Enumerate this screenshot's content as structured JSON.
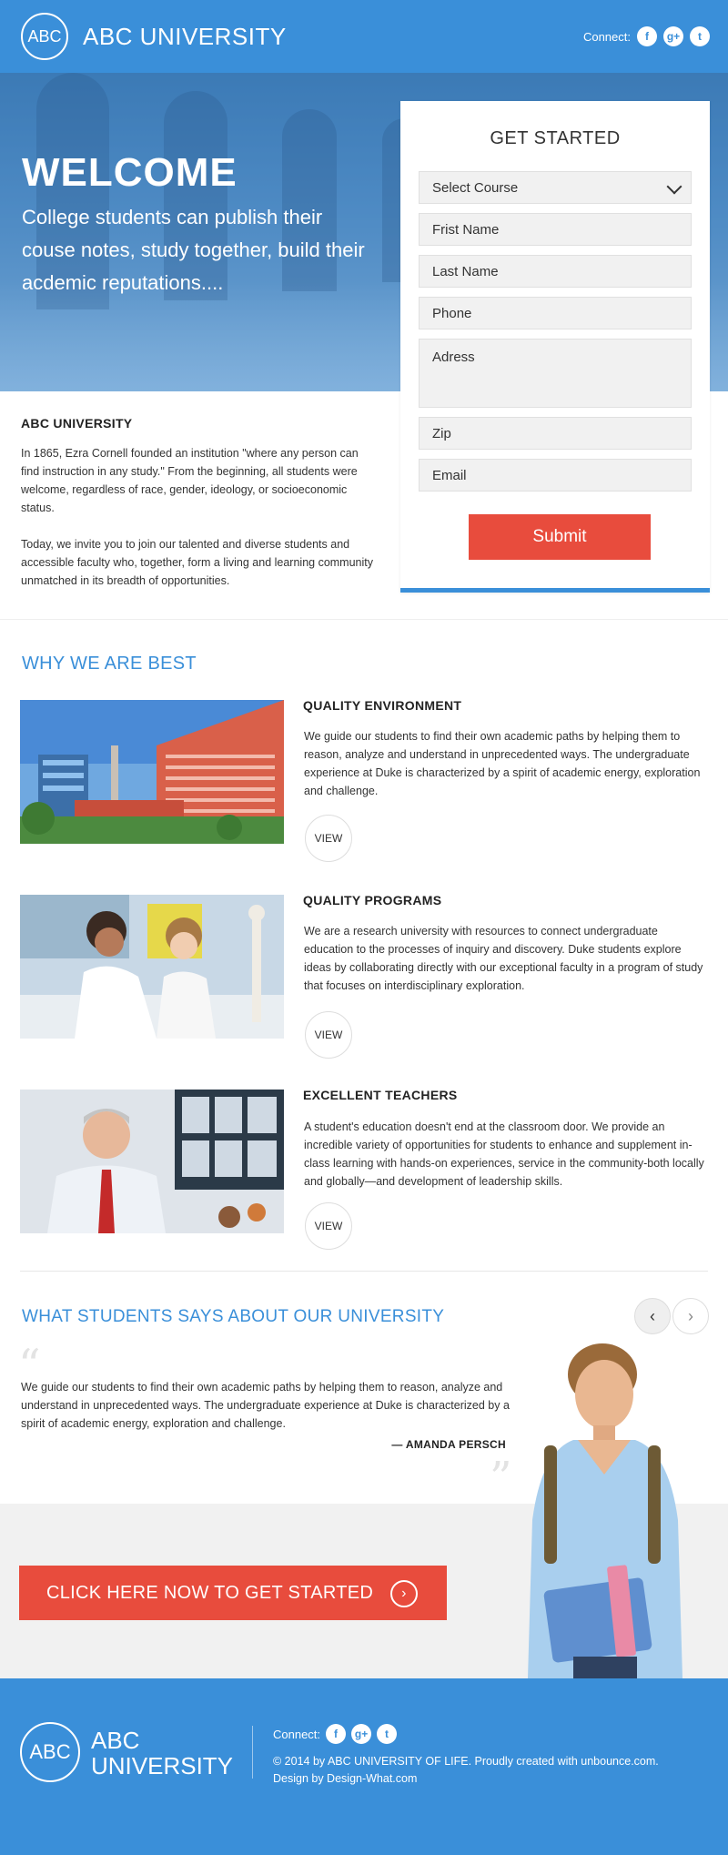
{
  "header": {
    "logo_mark": "ABC",
    "title": "ABC UNIVERSITY",
    "connect_label": "Connect:",
    "social": [
      {
        "icon": "facebook-icon",
        "glyph": "f"
      },
      {
        "icon": "google-plus-icon",
        "glyph": "g+"
      },
      {
        "icon": "twitter-icon",
        "glyph": "t"
      }
    ]
  },
  "hero": {
    "heading": "WELCOME",
    "tagline": "College students can publish their couse notes, study together, build their acdemic reputations...."
  },
  "form": {
    "title": "GET STARTED",
    "select_value": "Select Course",
    "first_name": "Frist Name",
    "last_name": "Last Name",
    "phone": "Phone",
    "address": "Adress",
    "zip": "Zip",
    "email": "Email",
    "submit_label": "Submit"
  },
  "about": {
    "title": "ABC UNIVERSITY",
    "p1": "In 1865, Ezra Cornell founded an institution \"where any person can find instruction in any study.\" From the beginning, all students were welcome, regardless of race, gender, ideology, or socioeconomic status.",
    "p2": "Today, we invite you to join our talented and diverse students and accessible faculty who, together, form a living and learning community unmatched in its breadth of opportunities."
  },
  "why": {
    "title": "WHY WE ARE BEST",
    "features": [
      {
        "heading": "QUALITY ENVIRONMENT",
        "text": "We guide our students to find their own academic paths by helping them to reason, analyze and understand in unprecedented ways. The undergraduate experience at Duke is characterized by a spirit of academic energy, exploration and challenge.",
        "button": "VIEW"
      },
      {
        "heading": "QUALITY PROGRAMS",
        "text": "We are a research university with resources to connect undergraduate education to the processes of inquiry and discovery. Duke students explore ideas by collaborating directly with our exceptional faculty in a program of study that focuses on interdisciplinary exploration.",
        "button": "VIEW"
      },
      {
        "heading": "EXCELLENT TEACHERS",
        "text": "A student's education doesn't end at the classroom door. We provide an incredible variety of opportunities for students to enhance and supplement in-class learning with hands-on experiences, service in the community-both locally and globally—and development of leadership skills.",
        "button": "VIEW"
      }
    ]
  },
  "testimonial": {
    "title": "WHAT STUDENTS SAYS ABOUT OUR UNIVERSITY",
    "text": "We guide our students to find their own academic paths by helping them to reason, analyze and understand in unprecedented ways. The undergraduate experience at Duke is characterized by a spirit of academic energy, exploration and challenge.",
    "author": "— AMANDA PERSCH",
    "prev": "‹",
    "next": "›"
  },
  "cta": {
    "label": "CLICK HERE NOW TO GET STARTED",
    "arrow": "›"
  },
  "footer": {
    "logo_mark": "ABC",
    "logo_line1": "ABC",
    "logo_line2": "UNIVERSITY",
    "connect_label": "Connect:",
    "copyright": "© 2014 by ABC UNIVERSITY OF LIFE. Proudly created with unbounce.com.",
    "credit": "Design by Design-What.com"
  },
  "colors": {
    "brand_blue": "#3a8fd9",
    "cta_red": "#e84c3d",
    "band_gray": "#f1f1f1"
  }
}
